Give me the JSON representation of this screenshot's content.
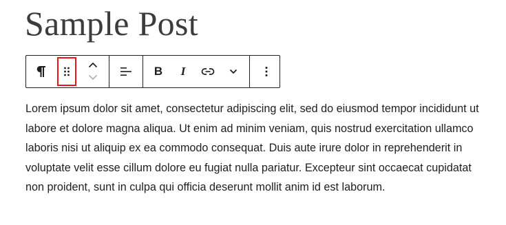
{
  "post": {
    "title": "Sample Post",
    "paragraph": "Lorem ipsum dolor sit amet, consectetur adipiscing elit, sed do eiusmod tempor incididunt ut labore et dolore magna aliqua. Ut enim ad minim veniam, quis nostrud exercitation ullamco laboris nisi ut aliquip ex ea commodo consequat. Duis aute irure dolor in reprehenderit in voluptate velit esse cillum dolore eu fugiat nulla pariatur. Excepteur sint occaecat cupidatat non proident, sunt in culpa qui officia deserunt mollit anim id est laborum."
  },
  "toolbar": {
    "block_type_icon": "pilcrow-icon",
    "drag_handle_icon": "drag-handle-icon",
    "move_up_icon": "chevron-up-icon",
    "move_down_icon": "chevron-down-icon",
    "align_icon": "align-left-icon",
    "bold_label": "B",
    "italic_label": "I",
    "link_icon": "link-icon",
    "more_formats_icon": "chevron-down-icon",
    "options_icon": "more-vertical-icon",
    "highlight_color": "#e11111"
  },
  "colors": {
    "text": "#1e1e1e",
    "title": "#3c3c3c",
    "disabled": "#b0b0b0"
  }
}
